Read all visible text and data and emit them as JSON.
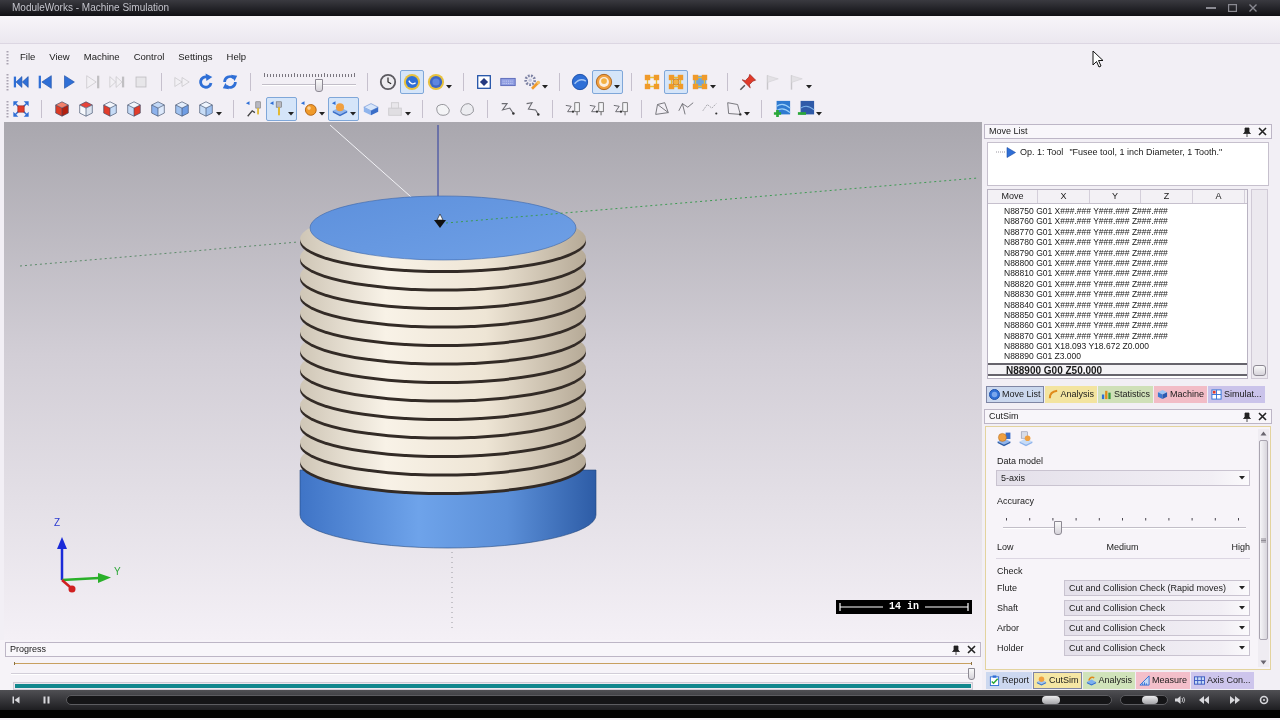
{
  "window": {
    "title": "ModuleWorks - Machine Simulation"
  },
  "menu": [
    "File",
    "View",
    "Machine",
    "Control",
    "Settings",
    "Help"
  ],
  "toolbars": [
    [
      {
        "kind": "buttons",
        "buttons": [
          {
            "pressed": false,
            "disabled": false,
            "caret": false
          },
          {
            "pressed": false,
            "disabled": false,
            "caret": false
          },
          {
            "pressed": false,
            "disabled": false,
            "caret": false
          },
          {
            "pressed": false,
            "disabled": true,
            "caret": false
          },
          {
            "pressed": false,
            "disabled": true,
            "caret": false
          },
          {
            "pressed": false,
            "disabled": true,
            "caret": false
          }
        ]
      },
      {
        "kind": "buttons",
        "buttons": [
          {
            "pressed": false,
            "disabled": true,
            "caret": false
          },
          {
            "pressed": false,
            "disabled": false,
            "caret": false
          },
          {
            "pressed": false,
            "disabled": false,
            "caret": false
          }
        ]
      },
      {
        "kind": "slider",
        "level": 0.62
      },
      {
        "kind": "buttons",
        "buttons": [
          {
            "pressed": false,
            "disabled": false,
            "caret": false
          },
          {
            "pressed": true,
            "disabled": false,
            "caret": false
          },
          {
            "pressed": false,
            "disabled": false,
            "caret": true
          }
        ]
      },
      {
        "kind": "buttons",
        "buttons": [
          {
            "pressed": false,
            "disabled": false,
            "caret": false
          },
          {
            "pressed": false,
            "disabled": false,
            "caret": false
          },
          {
            "pressed": false,
            "disabled": false,
            "caret": true
          }
        ]
      },
      {
        "kind": "buttons",
        "buttons": [
          {
            "pressed": false,
            "disabled": false,
            "caret": false
          },
          {
            "pressed": true,
            "disabled": false,
            "caret": true
          }
        ]
      },
      {
        "kind": "buttons",
        "buttons": [
          {
            "pressed": false,
            "disabled": false,
            "caret": false
          },
          {
            "pressed": true,
            "disabled": false,
            "caret": false
          },
          {
            "pressed": false,
            "disabled": false,
            "caret": true
          }
        ]
      },
      {
        "kind": "buttons",
        "buttons": [
          {
            "pressed": false,
            "disabled": false,
            "caret": false
          },
          {
            "pressed": false,
            "disabled": true,
            "caret": false
          },
          {
            "pressed": false,
            "disabled": true,
            "caret": true
          }
        ]
      }
    ],
    [
      {
        "kind": "buttons",
        "buttons": [
          {
            "pressed": false,
            "disabled": false,
            "caret": false
          }
        ]
      },
      {
        "kind": "buttons",
        "buttons": [
          {
            "pressed": false,
            "disabled": false,
            "caret": false
          },
          {
            "pressed": false,
            "disabled": false,
            "caret": false
          },
          {
            "pressed": false,
            "disabled": false,
            "caret": false
          },
          {
            "pressed": false,
            "disabled": false,
            "caret": false
          },
          {
            "pressed": false,
            "disabled": false,
            "caret": false
          },
          {
            "pressed": false,
            "disabled": false,
            "caret": false
          },
          {
            "pressed": false,
            "disabled": false,
            "caret": true
          }
        ]
      },
      {
        "kind": "buttons",
        "buttons": [
          {
            "pressed": false,
            "disabled": false,
            "caret": false
          },
          {
            "pressed": true,
            "disabled": false,
            "caret": true
          },
          {
            "pressed": false,
            "disabled": false,
            "caret": true
          },
          {
            "pressed": true,
            "disabled": false,
            "caret": true
          },
          {
            "pressed": false,
            "disabled": false,
            "caret": false
          },
          {
            "pressed": false,
            "disabled": true,
            "caret": true
          }
        ]
      },
      {
        "kind": "buttons",
        "buttons": [
          {
            "pressed": false,
            "disabled": false,
            "caret": false
          },
          {
            "pressed": false,
            "disabled": false,
            "caret": false
          }
        ]
      },
      {
        "kind": "buttons",
        "buttons": [
          {
            "pressed": false,
            "disabled": false,
            "caret": false
          },
          {
            "pressed": false,
            "disabled": false,
            "caret": false
          }
        ]
      },
      {
        "kind": "buttons",
        "buttons": [
          {
            "pressed": false,
            "disabled": false,
            "caret": false
          },
          {
            "pressed": false,
            "disabled": false,
            "caret": false
          },
          {
            "pressed": false,
            "disabled": false,
            "caret": false
          }
        ]
      },
      {
        "kind": "buttons",
        "buttons": [
          {
            "pressed": false,
            "disabled": false,
            "caret": false
          },
          {
            "pressed": false,
            "disabled": false,
            "caret": false
          },
          {
            "pressed": false,
            "disabled": false,
            "caret": false
          },
          {
            "pressed": false,
            "disabled": false,
            "caret": true
          }
        ]
      },
      {
        "kind": "buttons",
        "buttons": [
          {
            "pressed": false,
            "disabled": false,
            "caret": false
          },
          {
            "pressed": false,
            "disabled": false,
            "caret": true
          }
        ]
      }
    ]
  ],
  "viewport": {
    "axis_labels": [
      "Z",
      "Y"
    ],
    "scale_bar": "14 in"
  },
  "progress": {
    "title": "Progress",
    "slider": {
      "level": 1
    },
    "bar": {
      "level": 1
    }
  },
  "move_list": {
    "title": "Move List",
    "operation": {
      "label": "Op. 1: Tool",
      "tool": "\"Fusee tool, 1 inch Diameter, 1 Tooth.\""
    },
    "columns": [
      "Move",
      "X",
      "Y",
      "Z",
      "A"
    ],
    "rows": [
      {
        "text": "N88750 G01 X###.### Y###.### Z###.###",
        "selected": false
      },
      {
        "text": "N88760 G01 X###.### Y###.### Z###.###",
        "selected": false
      },
      {
        "text": "N88770 G01 X###.### Y###.### Z###.###",
        "selected": false
      },
      {
        "text": "N88780 G01 X###.### Y###.### Z###.###",
        "selected": false
      },
      {
        "text": "N88790 G01 X###.### Y###.### Z###.###",
        "selected": false
      },
      {
        "text": "N88800 G01 X###.### Y###.### Z###.###",
        "selected": false
      },
      {
        "text": "N88810 G01 X###.### Y###.### Z###.###",
        "selected": false
      },
      {
        "text": "N88820 G01 X###.### Y###.### Z###.###",
        "selected": false
      },
      {
        "text": "N88830 G01 X###.### Y###.### Z###.###",
        "selected": false
      },
      {
        "text": "N88840 G01 X###.### Y###.### Z###.###",
        "selected": false
      },
      {
        "text": "N88850 G01 X###.### Y###.### Z###.###",
        "selected": false
      },
      {
        "text": "N88860 G01 X###.### Y###.### Z###.###",
        "selected": false
      },
      {
        "text": "N88870 G01 X###.### Y###.### Z###.###",
        "selected": false
      },
      {
        "text": "N88880 G01 X18.093 Y18.672 Z0.000",
        "selected": false
      },
      {
        "text": "N88890 G01 Z3.000",
        "selected": false
      },
      {
        "text": "N88900 G00 Z50.000",
        "selected": true
      }
    ],
    "tabs": [
      {
        "label": "Move List",
        "selected": true,
        "color": "#cbd8ee"
      },
      {
        "label": "Analysis",
        "selected": false,
        "color": "#f3e4a0"
      },
      {
        "label": "Statistics",
        "selected": false,
        "color": "#cfe0b8"
      },
      {
        "label": "Machine",
        "selected": false,
        "color": "#f2bcc6"
      },
      {
        "label": "Simulat...",
        "selected": false,
        "color": "#cac3ea"
      }
    ]
  },
  "cutsim": {
    "title": "CutSim",
    "data_model": {
      "label": "Data model",
      "value": "5-axis"
    },
    "accuracy": {
      "label": "Accuracy",
      "level": 0.22,
      "scale": [
        "Low",
        "Medium",
        "High"
      ]
    },
    "check": {
      "label": "Check",
      "rows": [
        {
          "label": "Flute",
          "value": "Cut and Collision Check (Rapid moves)"
        },
        {
          "label": "Shaft",
          "value": "Cut and Collision Check"
        },
        {
          "label": "Arbor",
          "value": "Cut and Collision Check"
        },
        {
          "label": "Holder",
          "value": "Cut and Collision Check"
        }
      ]
    },
    "tabs": [
      {
        "label": "Report",
        "selected": false,
        "color": "#ccd8ef"
      },
      {
        "label": "CutSim",
        "selected": true,
        "color": "#f5e6a4"
      },
      {
        "label": "Analysis",
        "selected": false,
        "color": "#d0e3ba"
      },
      {
        "label": "Measure",
        "selected": false,
        "color": "#f3bfca"
      },
      {
        "label": "Axis Con...",
        "selected": false,
        "color": "#cdc5ec"
      }
    ]
  },
  "player": {
    "seek": {
      "level": 0.95
    },
    "volume": {
      "level": 0.7
    }
  }
}
